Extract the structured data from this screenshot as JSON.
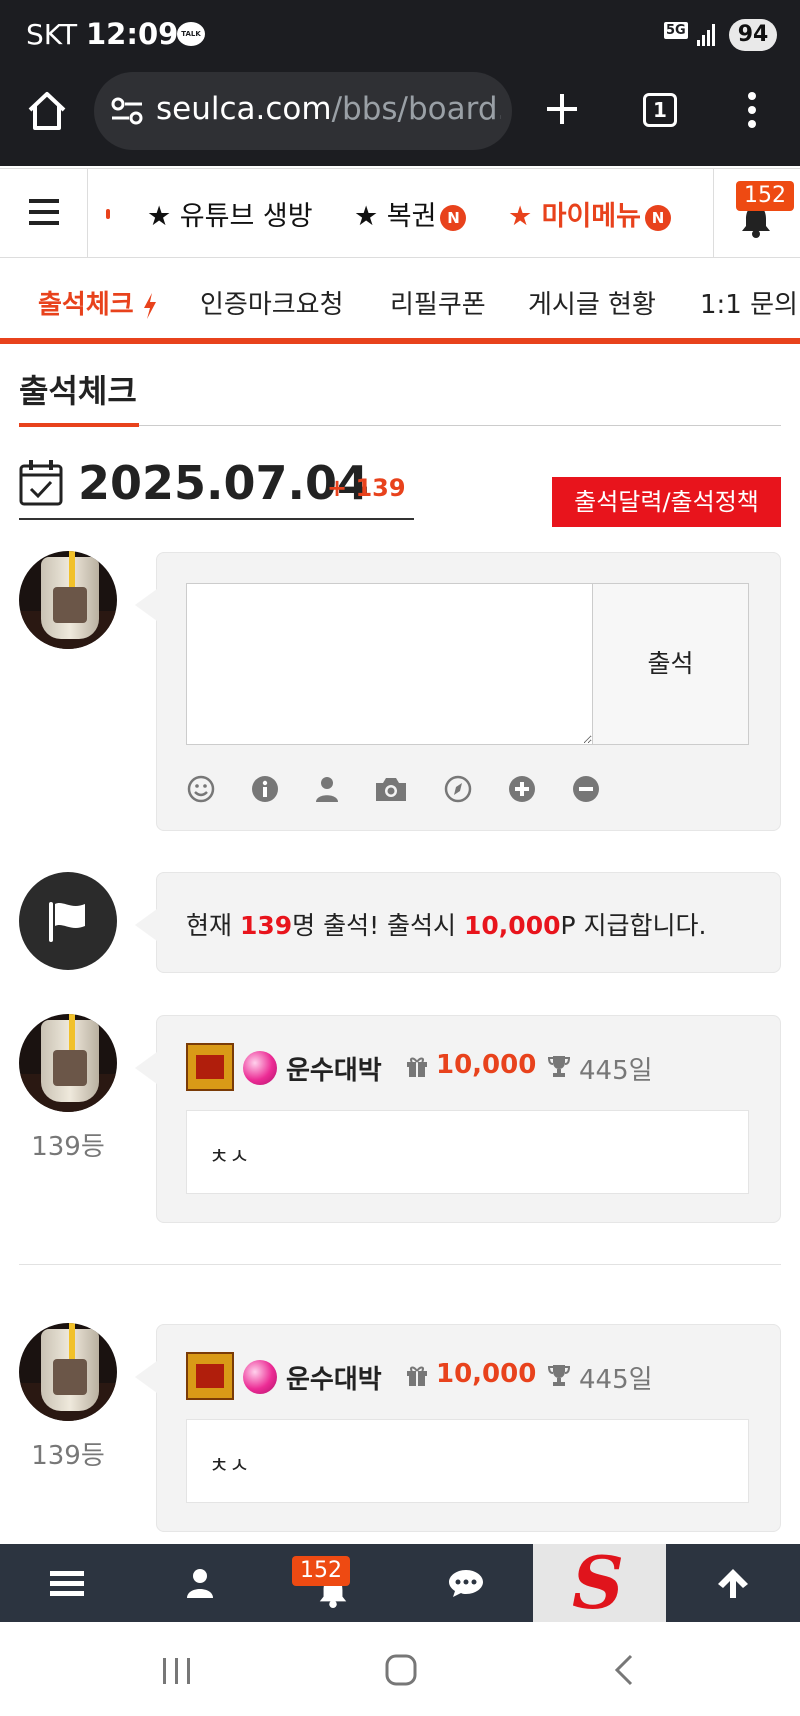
{
  "status_bar": {
    "carrier": "SKT",
    "time": "12:09",
    "talk_icon": "TALK",
    "network": "5G",
    "battery": "94"
  },
  "browser": {
    "url_domain": "seulca.com",
    "url_path": "/bbs/board.p",
    "tab_count": "1"
  },
  "site_nav": {
    "items": [
      {
        "label": "★ 유튜브 생방"
      },
      {
        "label": "★ 복권",
        "badge": "N"
      },
      {
        "label": "★ 마이메뉴",
        "badge": "N"
      }
    ],
    "notification_count": "152"
  },
  "sub_tabs": [
    "출석체크",
    "인증마크요청",
    "리필쿠폰",
    "게시글 현황",
    "1:1 문의"
  ],
  "page": {
    "title": "출석체크",
    "date": "2025.07.04",
    "plus_count": "+ 139",
    "policy_button": "출석달력/출석정책",
    "attend_button": "출석",
    "notice": {
      "pre": "현재 ",
      "count": "139",
      "mid": "명 출석! 출석시 ",
      "points": "10,000",
      "post": "P 지급합니다."
    }
  },
  "entries": [
    {
      "rank": "139등",
      "username": "운수대박",
      "points": "10,000",
      "days": "445일",
      "comment": "ㅊㅅ"
    },
    {
      "rank": "139등",
      "username": "운수대박",
      "points": "10,000",
      "days": "445일",
      "comment": "ㅊㅅ"
    }
  ],
  "bottom_bar": {
    "notification_count": "152",
    "logo": "S"
  },
  "colors": {
    "accent": "#e8421c",
    "red": "#e8141c",
    "dark": "#1c1d21",
    "toolbar": "#2c3440"
  }
}
